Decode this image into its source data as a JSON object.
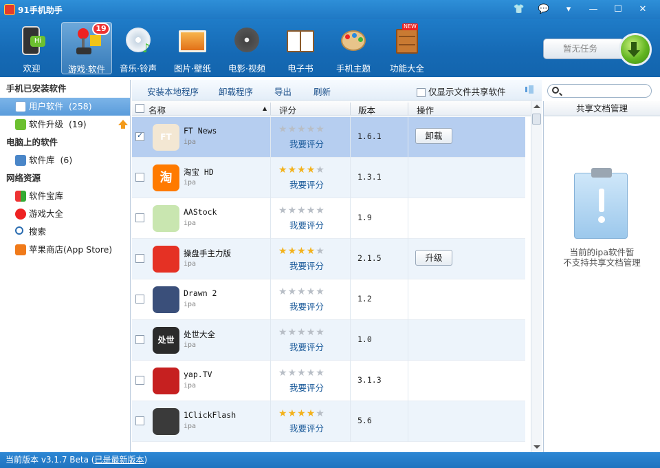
{
  "window": {
    "title": "91手机助手"
  },
  "toolbar": {
    "items": [
      {
        "label": "欢迎"
      },
      {
        "label": "游戏·软件",
        "badge": "19"
      },
      {
        "label": "音乐·铃声"
      },
      {
        "label": "图片·壁纸"
      },
      {
        "label": "电影·视频"
      },
      {
        "label": "电子书"
      },
      {
        "label": "手机主题"
      },
      {
        "label": "功能大全",
        "tag": "NEW"
      }
    ],
    "task_text": "暂无任务"
  },
  "sidebar": {
    "sections": [
      {
        "title": "手机已安装软件"
      },
      {
        "title": "电脑上的软件"
      },
      {
        "title": "网络资源"
      }
    ],
    "items": [
      {
        "label": "用户软件",
        "count": "(258)"
      },
      {
        "label": "软件升级",
        "count": "(19)"
      },
      {
        "label": "软件库",
        "count": "(6)"
      },
      {
        "label": "软件宝库"
      },
      {
        "label": "游戏大全"
      },
      {
        "label": "搜索"
      },
      {
        "label": "苹果商店(App Store)"
      }
    ]
  },
  "actions": {
    "install_local": "安装本地程序",
    "uninstall": "卸载程序",
    "export": "导出",
    "refresh": "刷新",
    "only_shared": "仅显示文件共享软件"
  },
  "table": {
    "headers": {
      "name": "名称",
      "rating": "评分",
      "version": "版本",
      "op": "操作"
    },
    "rate_label": "我要评分",
    "rows": [
      {
        "name": "FT News",
        "type": "ipa",
        "stars": 0,
        "version": "1.6.1",
        "op": "卸载",
        "checked": true,
        "icon_color": "#f3e7d3",
        "icon_text": "FT"
      },
      {
        "name": "淘宝 HD",
        "type": "ipa",
        "stars": 4,
        "version": "1.3.1",
        "op": "",
        "checked": false,
        "icon_color": "#ff7a00",
        "icon_text": "淘"
      },
      {
        "name": "AAStock",
        "type": "ipa",
        "stars": 0,
        "version": "1.9",
        "op": "",
        "checked": false,
        "icon_color": "#c9e6b0",
        "icon_text": ""
      },
      {
        "name": "操盘手主力版",
        "type": "ipa",
        "stars": 4,
        "version": "2.1.5",
        "op": "升级",
        "checked": false,
        "icon_color": "#e53124",
        "icon_text": ""
      },
      {
        "name": "Drawn 2",
        "type": "ipa",
        "stars": 0,
        "version": "1.2",
        "op": "",
        "checked": false,
        "icon_color": "#3a4f7a",
        "icon_text": ""
      },
      {
        "name": "处世大全",
        "type": "ipa",
        "stars": 0,
        "version": "1.0",
        "op": "",
        "checked": false,
        "icon_color": "#2b2b2b",
        "icon_text": "处世"
      },
      {
        "name": "yap.TV",
        "type": "ipa",
        "stars": 0,
        "version": "3.1.3",
        "op": "",
        "checked": false,
        "icon_color": "#c62020",
        "icon_text": ""
      },
      {
        "name": "1ClickFlash",
        "type": "ipa",
        "stars": 4,
        "version": "5.6",
        "op": "",
        "checked": false,
        "icon_color": "#3a3a3a",
        "icon_text": ""
      }
    ]
  },
  "right_panel": {
    "title": "共享文档管理",
    "message_line1": "当前的ipa软件暂",
    "message_line2": "不支持共享文档管理"
  },
  "status": {
    "version_text": "当前版本 v3.1.7 Beta",
    "latest_text": "已是最新版本"
  },
  "colors": {
    "titlebar": "#1f78c4",
    "accent": "#5a9cdb",
    "star": "#f3b21c",
    "link": "#1a5a9a"
  }
}
